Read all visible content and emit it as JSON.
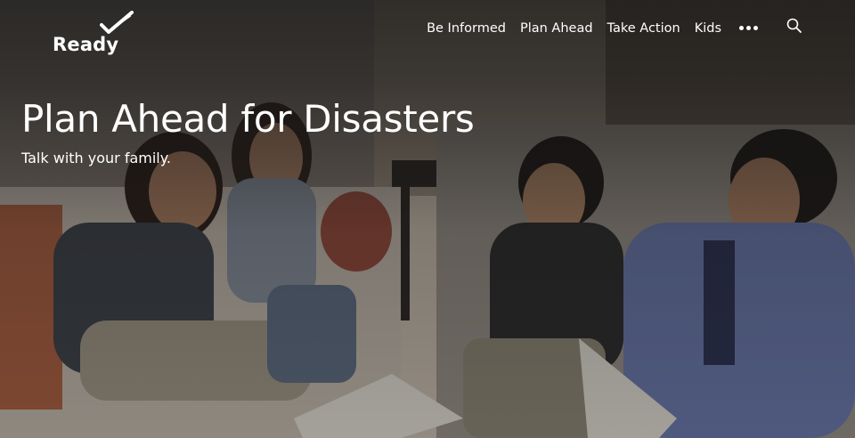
{
  "logo": {
    "text": "Ready"
  },
  "nav": {
    "items": [
      {
        "label": "Be Informed"
      },
      {
        "label": "Plan Ahead"
      },
      {
        "label": "Take Action"
      },
      {
        "label": "Kids"
      }
    ],
    "more_icon": "more-horizontal-icon",
    "search_icon": "search-icon"
  },
  "hero": {
    "title": "Plan Ahead for Disasters",
    "subtitle": "Talk with your family."
  },
  "colors": {
    "overlay": "#141414",
    "text": "#ffffff"
  }
}
